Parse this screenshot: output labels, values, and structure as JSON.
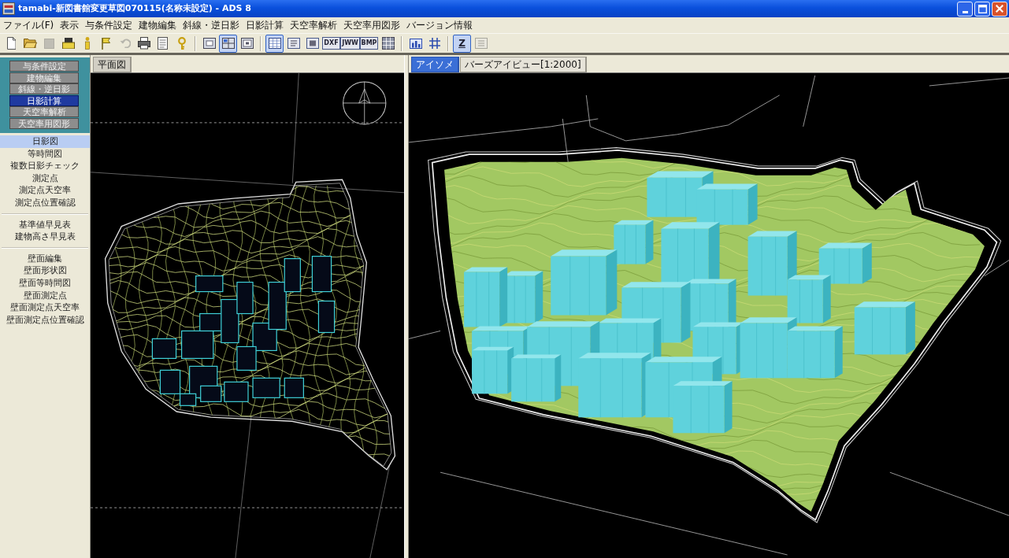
{
  "window": {
    "title": "tamabi-新図書館変更草図070115(名称未設定) - ADS 8"
  },
  "menu": [
    "ファイル(F)",
    "表示",
    "与条件設定",
    "建物編集",
    "斜線・逆日影",
    "日影計算",
    "天空率解析",
    "天空率用図形",
    "バージョン情報"
  ],
  "toolbar": [
    [
      {
        "pressed": false,
        "disabled": false
      },
      {
        "pressed": false,
        "disabled": false
      },
      {
        "pressed": false,
        "disabled": true
      },
      {
        "pressed": false,
        "disabled": false
      },
      {
        "pressed": false,
        "disabled": false
      },
      {
        "pressed": false,
        "disabled": false
      },
      {
        "pressed": false,
        "disabled": true
      },
      {
        "pressed": false,
        "disabled": false
      },
      {
        "pressed": false,
        "disabled": false
      },
      {
        "pressed": false,
        "disabled": false
      }
    ],
    [
      {
        "pressed": false,
        "disabled": false
      },
      {
        "pressed": true,
        "disabled": false
      },
      {
        "pressed": false,
        "disabled": false
      }
    ],
    [
      {
        "pressed": true,
        "disabled": false
      },
      {
        "pressed": false,
        "disabled": false
      },
      {
        "pressed": false,
        "disabled": false
      },
      {
        "label": "DXF",
        "pressed": false,
        "disabled": false
      },
      {
        "label": "JWW",
        "pressed": false,
        "disabled": false
      },
      {
        "label": "BMP",
        "pressed": false,
        "disabled": false
      },
      {
        "pressed": false,
        "disabled": false
      }
    ],
    [
      {
        "pressed": false,
        "disabled": false
      },
      {
        "pressed": false,
        "disabled": false
      }
    ],
    [
      {
        "label": "Z",
        "pressed": true,
        "disabled": false
      },
      {
        "pressed": false,
        "disabled": true
      }
    ]
  ],
  "sidebar": {
    "modes": [
      {
        "label": "与条件設定",
        "selected": false
      },
      {
        "label": "建物編集",
        "selected": false
      },
      {
        "label": "斜線・逆日影",
        "selected": false
      },
      {
        "label": "日影計算",
        "selected": true
      },
      {
        "label": "天空率解析",
        "selected": false
      },
      {
        "label": "天空率用図形",
        "selected": false
      }
    ],
    "tools": [
      [
        {
          "label": "日影図",
          "selected": true
        },
        {
          "label": "等時間図",
          "selected": false
        },
        {
          "label": "複数日影チェック",
          "selected": false
        },
        {
          "label": "測定点",
          "selected": false
        },
        {
          "label": "測定点天空率",
          "selected": false
        },
        {
          "label": "測定点位置確認",
          "selected": false
        }
      ],
      [
        {
          "label": "基準値早見表",
          "selected": false
        },
        {
          "label": "建物高さ早見表",
          "selected": false
        }
      ],
      [
        {
          "label": "壁面編集",
          "selected": false
        },
        {
          "label": "壁面形状図",
          "selected": false
        },
        {
          "label": "壁面等時間図",
          "selected": false
        },
        {
          "label": "壁面測定点",
          "selected": false
        },
        {
          "label": "壁面測定点天空率",
          "selected": false
        },
        {
          "label": "壁面測定点位置確認",
          "selected": false
        }
      ]
    ]
  },
  "plan_view": {
    "focused": false,
    "tabs": [
      {
        "label": "平面図",
        "selected": true
      }
    ]
  },
  "model_view": {
    "focused": true,
    "tabs": [
      {
        "label": "アイソメ",
        "selected": true
      },
      {
        "label": "バーズアイビュー[1:2000]",
        "selected": false
      }
    ]
  }
}
